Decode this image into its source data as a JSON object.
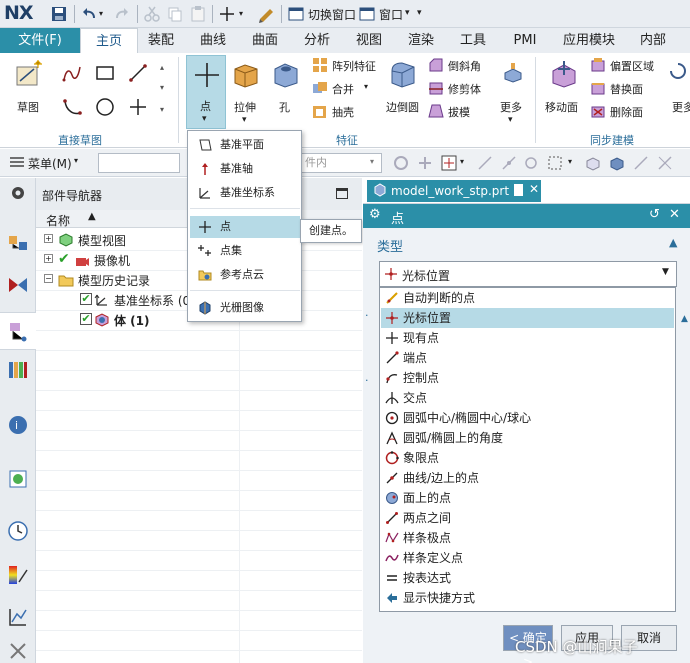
{
  "app": {
    "logo": "NX"
  },
  "quickaccess": {
    "switch_window": "切换窗口",
    "window": "窗口"
  },
  "tabs": {
    "file": "文件(F)",
    "items": [
      "主页",
      "装配",
      "曲线",
      "曲面",
      "分析",
      "视图",
      "渲染",
      "工具",
      "PMI",
      "应用模块",
      "内部"
    ],
    "active": 0
  },
  "ribbon": {
    "sketch": "草图",
    "direct_sketch_group": "直接草图",
    "point": "点",
    "pull": "拉伸",
    "hole": "孔",
    "array_feature": "阵列特征",
    "merge": "合并",
    "shell": "抽壳",
    "edge_blend": "边倒圆",
    "chamfer": "倒斜角",
    "trim_body": "修剪体",
    "draft": "拔模",
    "more1": "更多",
    "feature_group": "特征",
    "move_face": "移动面",
    "offset_region": "偏置区域",
    "replace_face": "替换面",
    "delete_face": "删除面",
    "more2": "更多",
    "sync_group": "同步建模"
  },
  "toolbar2": {
    "menu": "菜单(M)",
    "filter_placeholder": "件内"
  },
  "navigator": {
    "title": "部件导航器",
    "col_name": "名称",
    "tree": [
      {
        "label": "模型视图",
        "bold": false
      },
      {
        "label": "摄像机",
        "bold": false
      },
      {
        "label": "模型历史记录",
        "bold": false
      },
      {
        "label": "基准坐标系 (0",
        "bold": false
      },
      {
        "label": "体 (1)",
        "bold": true
      }
    ]
  },
  "feature_menu": {
    "items": [
      "基准平面",
      "基准轴",
      "基准坐标系",
      "点",
      "点集",
      "参考点云",
      "光栅图像"
    ],
    "selected": 3,
    "tooltip": "创建点。"
  },
  "document": {
    "tab": "model_work_stp.prt"
  },
  "dialog": {
    "title": "点",
    "section_type": "类型",
    "selected_type": "光标位置",
    "options": [
      "自动判断的点",
      "光标位置",
      "现有点",
      "端点",
      "控制点",
      "交点",
      "圆弧中心/椭圆中心/球心",
      "圆弧/椭圆上的角度",
      "象限点",
      "曲线/边上的点",
      "面上的点",
      "两点之间",
      "样条极点",
      "样条定义点",
      "按表达式",
      "显示快捷方式"
    ],
    "selected_index": 1,
    "ok": "< 确定 >",
    "apply": "应用",
    "cancel": "取消"
  },
  "watermark": "CSDN @山涧果子",
  "colors": {
    "accent": "#2b8fa8",
    "highlight": "#b6dae6",
    "group_label": "#2b6e9a"
  }
}
